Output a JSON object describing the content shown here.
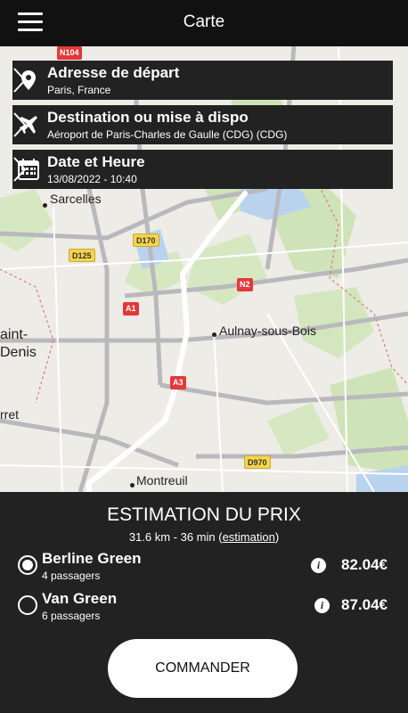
{
  "header": {
    "title": "Carte",
    "menu_icon": "hamburger-menu-icon"
  },
  "map": {
    "places": [
      "Sarcelles",
      "Aulnay-sous-Bois",
      "Montreuil",
      "aint-",
      "Denis",
      "rret"
    ],
    "roads": [
      "N104",
      "D170",
      "D125",
      "N2",
      "A1",
      "A3",
      "D970"
    ],
    "route_color": "#ffffff"
  },
  "trip": {
    "departure": {
      "title": "Adresse de départ",
      "value": "Paris, France",
      "icon": "location-pin-icon"
    },
    "destination": {
      "title": "Destination ou mise à dispo",
      "value": "Aéroport de Paris-Charles de Gaulle (CDG) (CDG)",
      "icon": "airplane-icon"
    },
    "datetime": {
      "title": "Date et Heure",
      "value": "13/08/2022 - 10:40",
      "icon": "calendar-icon"
    }
  },
  "estimate": {
    "title": "ESTIMATION DU PRIX",
    "summary": "31.6 km - 36 min (",
    "link": "estimation",
    "summary_end": ")"
  },
  "options": [
    {
      "name": "Berline Green",
      "passengers": "4 passagers",
      "price": "82.04€",
      "selected": true
    },
    {
      "name": "Van Green",
      "passengers": "6 passagers",
      "price": "87.04€",
      "selected": false
    }
  ],
  "cta": {
    "label": "COMMANDER"
  },
  "colors": {
    "background": "#222222",
    "header": "#111111",
    "map_bg": "#eeece6",
    "accent": "#ffffff"
  }
}
